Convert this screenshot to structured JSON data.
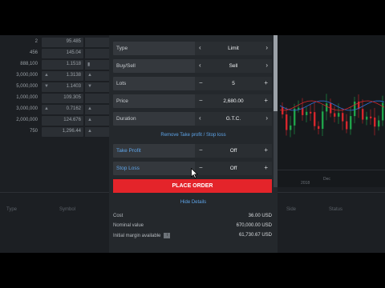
{
  "market_table": {
    "rows": [
      {
        "amount": "2",
        "price": "95.485",
        "arrow": "",
        "arrow2": ""
      },
      {
        "amount": "456",
        "price": "145.04",
        "arrow": "",
        "arrow2": ""
      },
      {
        "amount": "888,100",
        "price": "1.1518",
        "arrow": "",
        "arrow2": "▮"
      },
      {
        "amount": "3,000,000",
        "price": "1.3138",
        "arrow": "▲",
        "arrow2": "▲"
      },
      {
        "amount": "5,000,000",
        "price": "1.1403",
        "arrow": "▼",
        "arrow2": "▼"
      },
      {
        "amount": "1,000,000",
        "price": "109.305",
        "arrow": "",
        "arrow2": ""
      },
      {
        "amount": "3,000,000",
        "price": "0.7162",
        "arrow": "▲",
        "arrow2": "▲"
      },
      {
        "amount": "2,000,000",
        "price": "124.676",
        "arrow": "",
        "arrow2": "▲"
      },
      {
        "amount": "750",
        "price": "1,296.44",
        "arrow": "",
        "arrow2": "▲"
      }
    ]
  },
  "order_panel": {
    "type": {
      "label": "Type",
      "value": "Limit"
    },
    "buysell": {
      "label": "Buy/Sell",
      "value": "Sell"
    },
    "lots": {
      "label": "Lots",
      "value": "5"
    },
    "price": {
      "label": "Price",
      "value": "2,680.00"
    },
    "duration": {
      "label": "Duration",
      "value": "G.T.C."
    },
    "remove_link": "Remove Take profit / Stop loss",
    "take_profit": {
      "label": "Take Profit",
      "value": "Off"
    },
    "stop_loss": {
      "label": "Stop Loss",
      "value": "Off"
    },
    "place_order": "PLACE ORDER",
    "hide_details": "Hide Details",
    "summary": [
      {
        "key": "Cost",
        "value": "36.00 USD"
      },
      {
        "key": "Nominal value",
        "value": "670,000.00 USD"
      },
      {
        "key": "Initial margin available",
        "value": "61,730.67 USD"
      }
    ]
  },
  "chart": {
    "axis_labels": [
      "Dec",
      "2018"
    ]
  },
  "lower_headers": [
    "Type",
    "Symbol",
    "Side",
    "Status"
  ],
  "colors": {
    "accent": "#5ea4e8",
    "place_order": "#e4242a",
    "candle_up": "#1fa34a",
    "candle_down": "#d6262c"
  }
}
